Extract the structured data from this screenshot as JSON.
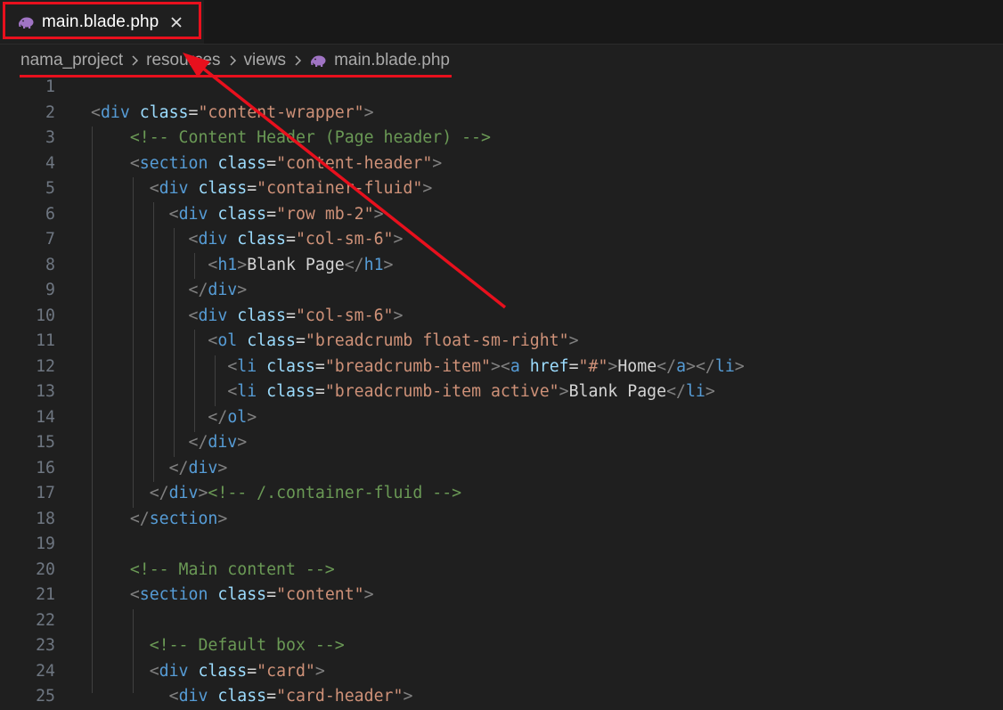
{
  "tab": {
    "label": "main.blade.php",
    "icon": "php-elephant-icon",
    "icon_color": "#a074c4"
  },
  "breadcrumb": {
    "items": [
      "nama_project",
      "resources",
      "views",
      "main.blade.php"
    ]
  },
  "annotation": {
    "highlight_color": "#e8101d"
  },
  "colors": {
    "tag": "#569cd6",
    "attr": "#9cdcfe",
    "string": "#ce9178",
    "comment": "#6a9955",
    "punct": "#808080",
    "text": "#d4d4d4"
  },
  "editor": {
    "lines": [
      {
        "n": "1",
        "tokens": []
      },
      {
        "n": "2",
        "tokens": [
          [
            "p",
            "<"
          ],
          [
            "g",
            "div"
          ],
          [
            "a",
            " class"
          ],
          [
            "t",
            "="
          ],
          [
            "s",
            "\"content-wrapper\""
          ],
          [
            "p",
            ">"
          ]
        ]
      },
      {
        "n": "3",
        "tokens": [
          [
            "t",
            "    "
          ],
          [
            "c",
            "<!-- Content Header (Page header) -->"
          ]
        ]
      },
      {
        "n": "4",
        "tokens": [
          [
            "t",
            "    "
          ],
          [
            "p",
            "<"
          ],
          [
            "g",
            "section"
          ],
          [
            "a",
            " class"
          ],
          [
            "t",
            "="
          ],
          [
            "s",
            "\"content-header\""
          ],
          [
            "p",
            ">"
          ]
        ]
      },
      {
        "n": "5",
        "tokens": [
          [
            "t",
            "      "
          ],
          [
            "p",
            "<"
          ],
          [
            "g",
            "div"
          ],
          [
            "a",
            " class"
          ],
          [
            "t",
            "="
          ],
          [
            "s",
            "\"container-fluid\""
          ],
          [
            "p",
            ">"
          ]
        ]
      },
      {
        "n": "6",
        "tokens": [
          [
            "t",
            "        "
          ],
          [
            "p",
            "<"
          ],
          [
            "g",
            "div"
          ],
          [
            "a",
            " class"
          ],
          [
            "t",
            "="
          ],
          [
            "s",
            "\"row mb-2\""
          ],
          [
            "p",
            ">"
          ]
        ]
      },
      {
        "n": "7",
        "tokens": [
          [
            "t",
            "          "
          ],
          [
            "p",
            "<"
          ],
          [
            "g",
            "div"
          ],
          [
            "a",
            " class"
          ],
          [
            "t",
            "="
          ],
          [
            "s",
            "\"col-sm-6\""
          ],
          [
            "p",
            ">"
          ]
        ]
      },
      {
        "n": "8",
        "tokens": [
          [
            "t",
            "            "
          ],
          [
            "p",
            "<"
          ],
          [
            "g",
            "h1"
          ],
          [
            "p",
            ">"
          ],
          [
            "t",
            "Blank Page"
          ],
          [
            "p",
            "</"
          ],
          [
            "g",
            "h1"
          ],
          [
            "p",
            ">"
          ]
        ]
      },
      {
        "n": "9",
        "tokens": [
          [
            "t",
            "          "
          ],
          [
            "p",
            "</"
          ],
          [
            "g",
            "div"
          ],
          [
            "p",
            ">"
          ]
        ]
      },
      {
        "n": "10",
        "tokens": [
          [
            "t",
            "          "
          ],
          [
            "p",
            "<"
          ],
          [
            "g",
            "div"
          ],
          [
            "a",
            " class"
          ],
          [
            "t",
            "="
          ],
          [
            "s",
            "\"col-sm-6\""
          ],
          [
            "p",
            ">"
          ]
        ]
      },
      {
        "n": "11",
        "tokens": [
          [
            "t",
            "            "
          ],
          [
            "p",
            "<"
          ],
          [
            "g",
            "ol"
          ],
          [
            "a",
            " class"
          ],
          [
            "t",
            "="
          ],
          [
            "s",
            "\"breadcrumb float-sm-right\""
          ],
          [
            "p",
            ">"
          ]
        ]
      },
      {
        "n": "12",
        "tokens": [
          [
            "t",
            "              "
          ],
          [
            "p",
            "<"
          ],
          [
            "g",
            "li"
          ],
          [
            "a",
            " class"
          ],
          [
            "t",
            "="
          ],
          [
            "s",
            "\"breadcrumb-item\""
          ],
          [
            "p",
            "><"
          ],
          [
            "g",
            "a"
          ],
          [
            "a",
            " href"
          ],
          [
            "t",
            "="
          ],
          [
            "s",
            "\"#\""
          ],
          [
            "p",
            ">"
          ],
          [
            "t",
            "Home"
          ],
          [
            "p",
            "</"
          ],
          [
            "g",
            "a"
          ],
          [
            "p",
            "></"
          ],
          [
            "g",
            "li"
          ],
          [
            "p",
            ">"
          ]
        ]
      },
      {
        "n": "13",
        "tokens": [
          [
            "t",
            "              "
          ],
          [
            "p",
            "<"
          ],
          [
            "g",
            "li"
          ],
          [
            "a",
            " class"
          ],
          [
            "t",
            "="
          ],
          [
            "s",
            "\"breadcrumb-item active\""
          ],
          [
            "p",
            ">"
          ],
          [
            "t",
            "Blank Page"
          ],
          [
            "p",
            "</"
          ],
          [
            "g",
            "li"
          ],
          [
            "p",
            ">"
          ]
        ]
      },
      {
        "n": "14",
        "tokens": [
          [
            "t",
            "            "
          ],
          [
            "p",
            "</"
          ],
          [
            "g",
            "ol"
          ],
          [
            "p",
            ">"
          ]
        ]
      },
      {
        "n": "15",
        "tokens": [
          [
            "t",
            "          "
          ],
          [
            "p",
            "</"
          ],
          [
            "g",
            "div"
          ],
          [
            "p",
            ">"
          ]
        ]
      },
      {
        "n": "16",
        "tokens": [
          [
            "t",
            "        "
          ],
          [
            "p",
            "</"
          ],
          [
            "g",
            "div"
          ],
          [
            "p",
            ">"
          ]
        ]
      },
      {
        "n": "17",
        "tokens": [
          [
            "t",
            "      "
          ],
          [
            "p",
            "</"
          ],
          [
            "g",
            "div"
          ],
          [
            "p",
            ">"
          ],
          [
            "c",
            "<!-- /.container-fluid -->"
          ]
        ]
      },
      {
        "n": "18",
        "tokens": [
          [
            "t",
            "    "
          ],
          [
            "p",
            "</"
          ],
          [
            "g",
            "section"
          ],
          [
            "p",
            ">"
          ]
        ]
      },
      {
        "n": "19",
        "tokens": []
      },
      {
        "n": "20",
        "tokens": [
          [
            "t",
            "    "
          ],
          [
            "c",
            "<!-- Main content -->"
          ]
        ]
      },
      {
        "n": "21",
        "tokens": [
          [
            "t",
            "    "
          ],
          [
            "p",
            "<"
          ],
          [
            "g",
            "section"
          ],
          [
            "a",
            " class"
          ],
          [
            "t",
            "="
          ],
          [
            "s",
            "\"content\""
          ],
          [
            "p",
            ">"
          ]
        ]
      },
      {
        "n": "22",
        "tokens": []
      },
      {
        "n": "23",
        "tokens": [
          [
            "t",
            "      "
          ],
          [
            "c",
            "<!-- Default box -->"
          ]
        ]
      },
      {
        "n": "24",
        "tokens": [
          [
            "t",
            "      "
          ],
          [
            "p",
            "<"
          ],
          [
            "g",
            "div"
          ],
          [
            "a",
            " class"
          ],
          [
            "t",
            "="
          ],
          [
            "s",
            "\"card\""
          ],
          [
            "p",
            ">"
          ]
        ]
      },
      {
        "n": "25",
        "tokens": [
          [
            "t",
            "        "
          ],
          [
            "p",
            "<"
          ],
          [
            "g",
            "div"
          ],
          [
            "a",
            " class"
          ],
          [
            "t",
            "="
          ],
          [
            "s",
            "\"card-header\""
          ],
          [
            "p",
            ">"
          ]
        ]
      }
    ]
  }
}
